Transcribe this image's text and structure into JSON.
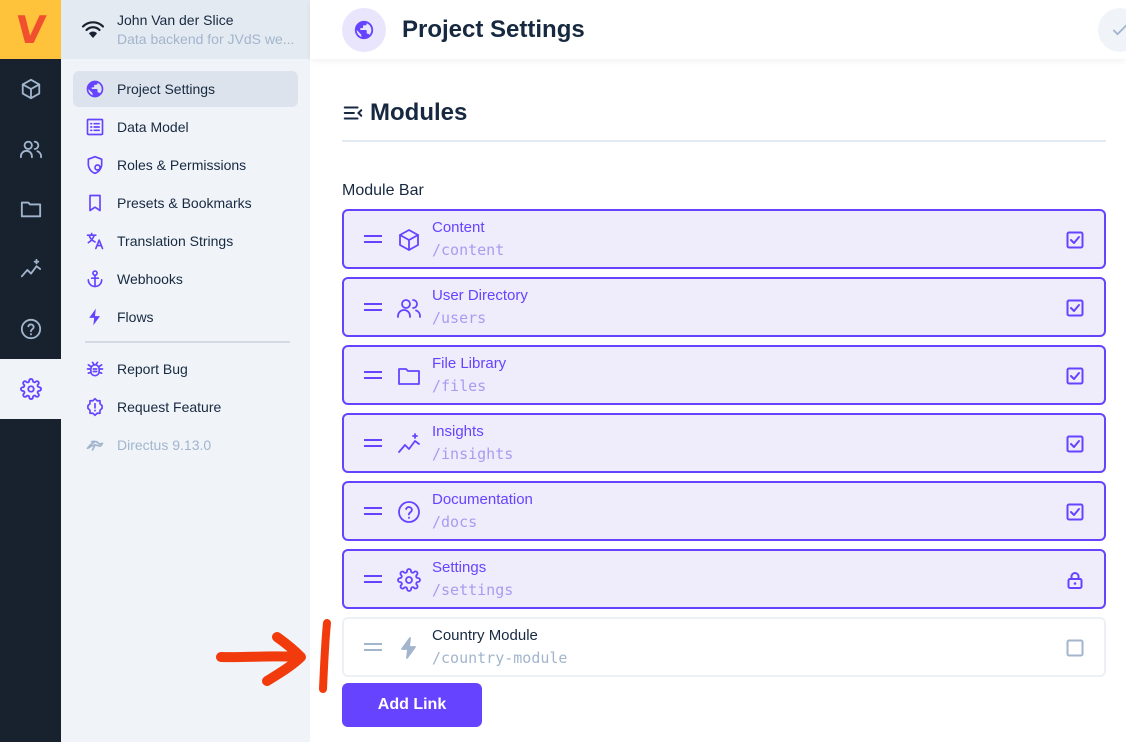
{
  "app": {
    "logo_text": "V",
    "accent_color": "#6644ff",
    "rail_items": [
      {
        "icon": "box-icon"
      },
      {
        "icon": "users-icon"
      },
      {
        "icon": "folder-icon"
      },
      {
        "icon": "insights-icon"
      },
      {
        "icon": "help-icon"
      },
      {
        "icon": "gear-icon",
        "active": true
      }
    ]
  },
  "project": {
    "name": "John Van der Slice",
    "description": "Data backend for JVdS we..."
  },
  "nav": {
    "items": [
      {
        "label": "Project Settings",
        "icon": "globe-icon",
        "active": true
      },
      {
        "label": "Data Model",
        "icon": "list-icon"
      },
      {
        "label": "Roles & Permissions",
        "icon": "shield-icon"
      },
      {
        "label": "Presets & Bookmarks",
        "icon": "bookmark-icon"
      },
      {
        "label": "Translation Strings",
        "icon": "translate-icon"
      },
      {
        "label": "Webhooks",
        "icon": "anchor-icon"
      },
      {
        "label": "Flows",
        "icon": "bolt-icon"
      }
    ],
    "extra": [
      {
        "label": "Report Bug",
        "icon": "bug-icon"
      },
      {
        "label": "Request Feature",
        "icon": "alert-icon"
      }
    ],
    "version": "Directus 9.13.0"
  },
  "header": {
    "title": "Project Settings"
  },
  "main": {
    "section_title": "Modules",
    "field_label": "Module Bar",
    "modules": [
      {
        "name": "Content",
        "path": "/content",
        "icon": "box-icon",
        "enabled": true,
        "state": "checked"
      },
      {
        "name": "User Directory",
        "path": "/users",
        "icon": "users-icon",
        "enabled": true,
        "state": "checked"
      },
      {
        "name": "File Library",
        "path": "/files",
        "icon": "folder-icon",
        "enabled": true,
        "state": "checked"
      },
      {
        "name": "Insights",
        "path": "/insights",
        "icon": "insights-icon",
        "enabled": true,
        "state": "checked"
      },
      {
        "name": "Documentation",
        "path": "/docs",
        "icon": "help-icon",
        "enabled": true,
        "state": "checked"
      },
      {
        "name": "Settings",
        "path": "/settings",
        "icon": "gear-icon",
        "enabled": true,
        "state": "locked"
      },
      {
        "name": "Country Module",
        "path": "/country-module",
        "icon": "bolt-icon",
        "enabled": false,
        "state": "unchecked"
      }
    ],
    "add_button": "Add Link"
  }
}
